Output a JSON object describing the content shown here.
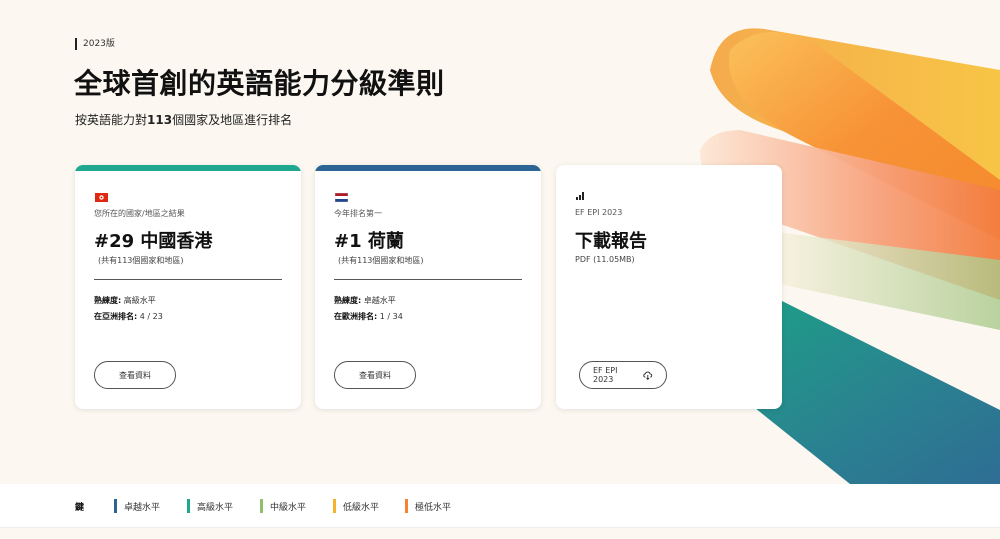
{
  "hero": {
    "edition": "2023版",
    "title": "全球首創的英語能力分級準則",
    "subtitle_pre": "按英語能力對",
    "subtitle_num": "113",
    "subtitle_post": "個國家及地區進行排名"
  },
  "colors": {
    "teal": "#1fa88f",
    "blue": "#2c6494",
    "orange": "#f7822f",
    "yellow": "#f4b42a",
    "green": "#8fbf6a",
    "darkteal": "#1a8a85"
  },
  "cards": [
    {
      "bar_color": "#1fa88f",
      "flag_icon": "hong-kong-flag-icon",
      "caption": "您所在的國家/地區之結果",
      "big": "#29 中國香港",
      "small": "(共有113個國家和地區)",
      "row1_label": "熟練度:",
      "row1_value": " 高級水平",
      "row2_label": "在亞洲排名:",
      "row2_value": " 4 / 23",
      "button": "查看資料"
    },
    {
      "bar_color": "#2c6494",
      "flag_icon": "netherlands-flag-icon",
      "caption": "今年排名第一",
      "big": "#1 荷蘭",
      "small": "(共有113個國家和地區)",
      "row1_label": "熟練度:",
      "row1_value": " 卓越水平",
      "row2_label": "在歐洲排名:",
      "row2_value": " 1 / 34",
      "button": "查看資料"
    },
    {
      "icon": "bar-chart-icon",
      "caption": "EF EPI 2023",
      "big": "下載報告",
      "small": "PDF (11.05MB)",
      "button": "EF EPI 2023",
      "button_icon": "cloud-download-icon"
    }
  ],
  "legend": {
    "key": "鍵",
    "items": [
      {
        "label": "卓越水平",
        "color": "#2c6494"
      },
      {
        "label": "高級水平",
        "color": "#1fa88f"
      },
      {
        "label": "中級水平",
        "color": "#8fbf6a"
      },
      {
        "label": "低級水平",
        "color": "#f4b42a"
      },
      {
        "label": "極低水平",
        "color": "#f7822f"
      }
    ]
  }
}
